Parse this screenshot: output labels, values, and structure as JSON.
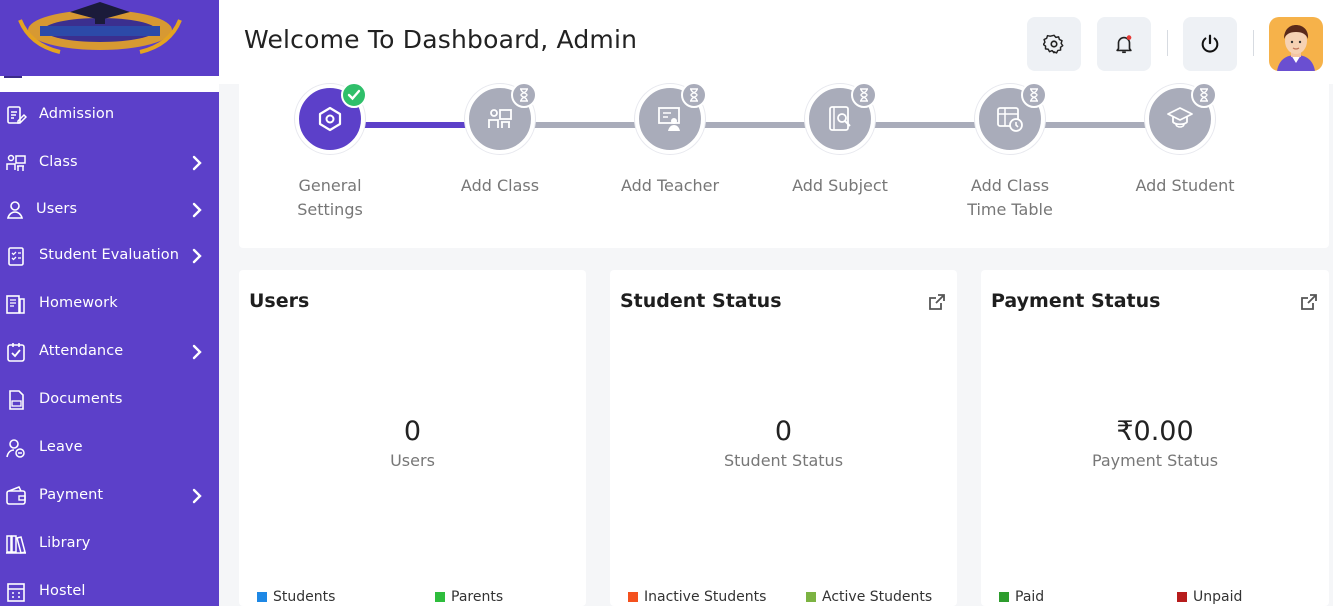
{
  "header": {
    "title": "Welcome To Dashboard, Admin"
  },
  "sidebar": {
    "items": [
      {
        "label": "Admission",
        "icon": "edit-document-icon",
        "has_submenu": false
      },
      {
        "label": "Class",
        "icon": "classroom-icon",
        "has_submenu": true
      },
      {
        "label": "Users",
        "icon": "user-icon",
        "has_submenu": true
      },
      {
        "label": "Student Evaluation",
        "icon": "checklist-icon",
        "has_submenu": true
      },
      {
        "label": "Homework",
        "icon": "homework-icon",
        "has_submenu": false
      },
      {
        "label": "Attendance",
        "icon": "attendance-check-icon",
        "has_submenu": true
      },
      {
        "label": "Documents",
        "icon": "document-icon",
        "has_submenu": false
      },
      {
        "label": "Leave",
        "icon": "leave-icon",
        "has_submenu": false
      },
      {
        "label": "Payment",
        "icon": "wallet-icon",
        "has_submenu": true
      },
      {
        "label": "Library",
        "icon": "library-icon",
        "has_submenu": false
      },
      {
        "label": "Hostel",
        "icon": "hostel-icon",
        "has_submenu": false
      }
    ]
  },
  "stepper": {
    "steps": [
      {
        "label": "General Settings",
        "status": "completed",
        "icon": "settings-hexagon-icon"
      },
      {
        "label": "Add Class",
        "status": "pending",
        "icon": "classroom-icon"
      },
      {
        "label": "Add Teacher",
        "status": "pending",
        "icon": "teacher-icon"
      },
      {
        "label": "Add Subject",
        "status": "pending",
        "icon": "subject-book-icon"
      },
      {
        "label": "Add Class Time Table",
        "status": "pending",
        "icon": "timetable-icon"
      },
      {
        "label": "Add Student",
        "status": "pending",
        "icon": "student-cap-icon"
      }
    ]
  },
  "cards": {
    "users": {
      "title": "Users",
      "value": "0",
      "subtitle": "Users",
      "legend": [
        {
          "label": "Students",
          "color": "#1e88e5"
        },
        {
          "label": "Parents",
          "color": "#2ebd3d"
        }
      ]
    },
    "student_status": {
      "title": "Student Status",
      "value": "0",
      "subtitle": "Student Status",
      "legend": [
        {
          "label": "Inactive Students",
          "color": "#f4511e"
        },
        {
          "label": "Active Students",
          "color": "#7cb342"
        }
      ]
    },
    "payment_status": {
      "title": "Payment Status",
      "value": "₹0.00",
      "subtitle": "Payment Status",
      "legend": [
        {
          "label": "Paid",
          "color": "#2e9d2e"
        },
        {
          "label": "Unpaid",
          "color": "#b71c1c"
        }
      ]
    }
  },
  "colors": {
    "sidebar": "#5c40c9",
    "step_done": "#5c40c9",
    "step_pending": "#a9acba",
    "check": "#2fbf6a"
  }
}
